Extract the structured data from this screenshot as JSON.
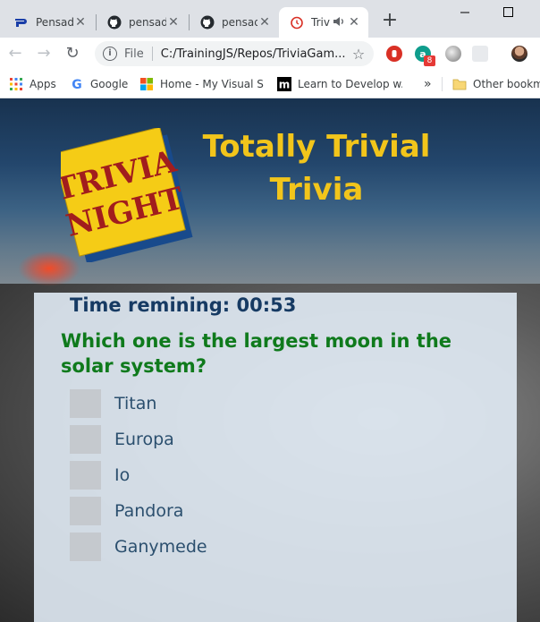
{
  "browser": {
    "tabs": [
      {
        "title": "Pensad",
        "icon": "pensado-icon",
        "active": false
      },
      {
        "title": "pensad",
        "icon": "github-icon",
        "active": false
      },
      {
        "title": "pensad",
        "icon": "github-icon",
        "active": false
      },
      {
        "title": "Triv",
        "icon": "clock-icon",
        "active": true
      }
    ],
    "address": {
      "scheme": "File",
      "url": "C:/TrainingJS/Repos/TriviaGam..."
    },
    "extensions": {
      "badge_count": "8"
    },
    "bookmarks": [
      {
        "label": "Apps",
        "icon": "apps-grid-icon"
      },
      {
        "label": "Google",
        "icon": "google-icon"
      },
      {
        "label": "Home - My Visual S...",
        "icon": "microsoft-icon"
      },
      {
        "label": "Learn to Develop w...",
        "icon": "m-logo-icon"
      },
      {
        "label": "»",
        "icon": "overflow-chevron-icon"
      },
      {
        "label": "Other bookmarks",
        "icon": "folder-icon"
      }
    ]
  },
  "app": {
    "logo": {
      "line1": "TRIVIA",
      "line2": "NIGHT"
    },
    "title": "Totally Trivial Trivia",
    "timer_label": "Time remining: 00:53",
    "question": "Which one is the largest moon in the solar system?",
    "answers": [
      "Titan",
      "Europa",
      "Io",
      "Pandora",
      "Ganymede"
    ]
  },
  "colors": {
    "title_yellow": "#f2c51b",
    "question_green": "#0f7a1c",
    "timer_navy": "#163a63",
    "answer_text": "#2b4f6e"
  }
}
